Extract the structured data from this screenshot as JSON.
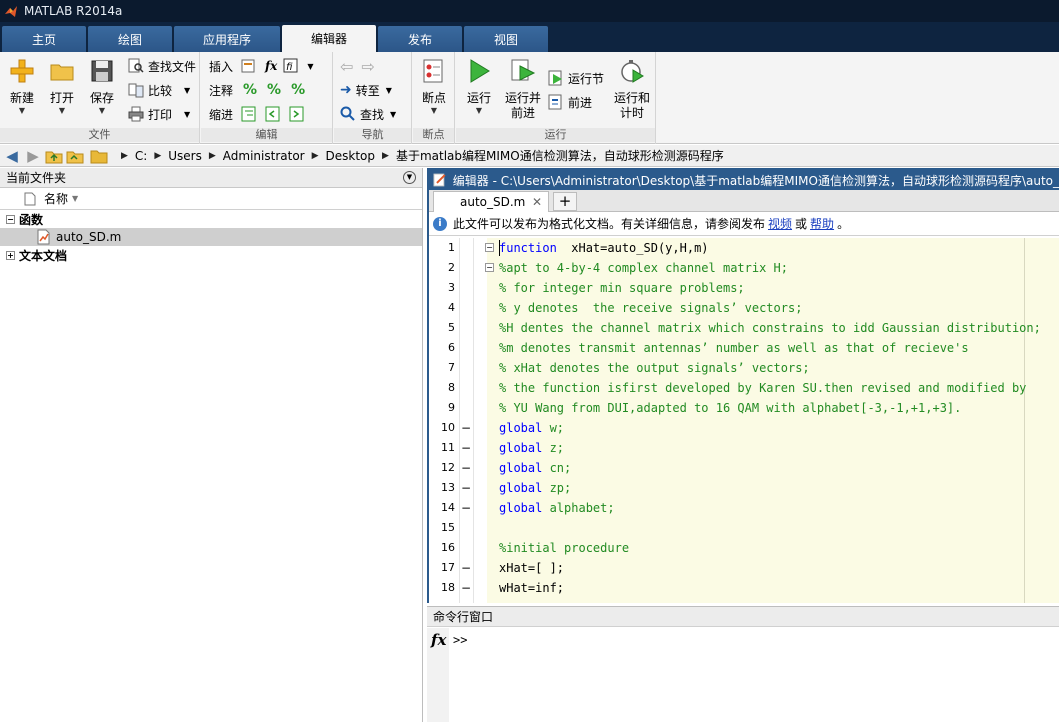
{
  "window": {
    "title": "MATLAB R2014a"
  },
  "tabs": [
    {
      "label": "主页"
    },
    {
      "label": "绘图"
    },
    {
      "label": "应用程序"
    },
    {
      "label": "编辑器"
    },
    {
      "label": "发布"
    },
    {
      "label": "视图"
    }
  ],
  "active_tab": "编辑器",
  "ribbon": {
    "file": {
      "label": "文件",
      "new": "新建",
      "open": "打开",
      "save": "保存",
      "find_files": "查找文件",
      "compare": "比较",
      "print": "打印"
    },
    "edit": {
      "label": "编辑",
      "insert": "插入",
      "comment": "注释",
      "indent": "缩进",
      "fx": "fx"
    },
    "navigate": {
      "label": "导航",
      "goto": "转至",
      "find": "查找"
    },
    "breakpoints": {
      "label": "断点",
      "breakpoints": "断点"
    },
    "run": {
      "label": "运行",
      "run": "运行",
      "run_advance": "运行并\n前进",
      "run_section": "运行节",
      "advance": "前进",
      "run_time": "运行和\n计时"
    }
  },
  "address": {
    "crumbs": [
      "C:",
      "Users",
      "Administrator",
      "Desktop",
      "基于matlab编程MIMO通信检测算法，自动球形检测源码程序"
    ]
  },
  "left_panel": {
    "title": "当前文件夹",
    "column": "名称",
    "groups": [
      {
        "label": "函数",
        "expander": "−",
        "items": [
          {
            "label": "auto_SD.m"
          }
        ]
      },
      {
        "label": "文本文档",
        "expander": "+"
      }
    ]
  },
  "editor": {
    "title": "编辑器 - C:\\Users\\Administrator\\Desktop\\基于matlab编程MIMO通信检测算法，自动球形检测源码程序\\auto_",
    "tab": "auto_SD.m",
    "tab_close": "✕",
    "add_tab": "+",
    "info": {
      "text": "此文件可以发布为格式化文档。有关详细信息，请参阅发布",
      "link1": "视频",
      "or": "或",
      "link2": "帮助",
      "end": "。"
    },
    "lines": [
      {
        "n": "1",
        "mark": "",
        "fold": "−",
        "parts": [
          {
            "c": "kw",
            "t": "function"
          },
          {
            "c": "",
            "t": "  xHat=auto_SD(y,H,m)"
          }
        ]
      },
      {
        "n": "2",
        "mark": "",
        "fold": "−",
        "parts": [
          {
            "c": "cm",
            "t": "%apt to 4-by-4 complex channel matrix H;"
          }
        ]
      },
      {
        "n": "3",
        "mark": "",
        "fold": "",
        "parts": [
          {
            "c": "cm",
            "t": "% for integer min square problems;"
          }
        ]
      },
      {
        "n": "4",
        "mark": "",
        "fold": "",
        "parts": [
          {
            "c": "cm",
            "t": "% y denotes  the receive signals’ vectors;"
          }
        ]
      },
      {
        "n": "5",
        "mark": "",
        "fold": "",
        "parts": [
          {
            "c": "cm",
            "t": "%H dentes the channel matrix which constrains to idd Gaussian distribution;"
          }
        ]
      },
      {
        "n": "6",
        "mark": "",
        "fold": "",
        "parts": [
          {
            "c": "cm",
            "t": "%m denotes transmit antennas’ number as well as that of recieve's"
          }
        ]
      },
      {
        "n": "7",
        "mark": "",
        "fold": "",
        "parts": [
          {
            "c": "cm",
            "t": "% xHat denotes the output signals’ vectors;"
          }
        ]
      },
      {
        "n": "8",
        "mark": "",
        "fold": "",
        "parts": [
          {
            "c": "cm",
            "t": "% the function isfirst developed by Karen SU.then revised and modified by"
          }
        ]
      },
      {
        "n": "9",
        "mark": "",
        "fold": "",
        "parts": [
          {
            "c": "cm",
            "t": "% YU Wang from DUI,adapted to 16 QAM with alphabet[-3,-1,+1,+3]."
          }
        ]
      },
      {
        "n": "10",
        "mark": "−",
        "fold": "",
        "parts": [
          {
            "c": "kw",
            "t": "global"
          },
          {
            "c": "cm",
            "t": " w;"
          }
        ]
      },
      {
        "n": "11",
        "mark": "−",
        "fold": "",
        "parts": [
          {
            "c": "kw",
            "t": "global"
          },
          {
            "c": "cm",
            "t": " z;"
          }
        ]
      },
      {
        "n": "12",
        "mark": "−",
        "fold": "",
        "parts": [
          {
            "c": "kw",
            "t": "global"
          },
          {
            "c": "cm",
            "t": " cn;"
          }
        ]
      },
      {
        "n": "13",
        "mark": "−",
        "fold": "",
        "parts": [
          {
            "c": "kw",
            "t": "global"
          },
          {
            "c": "cm",
            "t": " zp;"
          }
        ]
      },
      {
        "n": "14",
        "mark": "−",
        "fold": "",
        "parts": [
          {
            "c": "kw",
            "t": "global"
          },
          {
            "c": "cm",
            "t": " alphabet;"
          }
        ]
      },
      {
        "n": "15",
        "mark": "",
        "fold": "",
        "parts": []
      },
      {
        "n": "16",
        "mark": "",
        "fold": "",
        "parts": [
          {
            "c": "cm",
            "t": "%initial procedure"
          }
        ]
      },
      {
        "n": "17",
        "mark": "−",
        "fold": "",
        "parts": [
          {
            "c": "",
            "t": "xHat=[ ];"
          }
        ]
      },
      {
        "n": "18",
        "mark": "−",
        "fold": "",
        "parts": [
          {
            "c": "",
            "t": "wHat=inf;"
          }
        ]
      }
    ]
  },
  "command_window": {
    "title": "命令行窗口",
    "fx": "fx",
    "prompt": ">>"
  },
  "colors": {
    "titlebar": "#0b1a2e",
    "tab": "#2c5688",
    "editor_border": "#2b5a8c",
    "code_bg": "#fbfbe4",
    "comment": "#228b22",
    "keyword": "#0000ff"
  }
}
